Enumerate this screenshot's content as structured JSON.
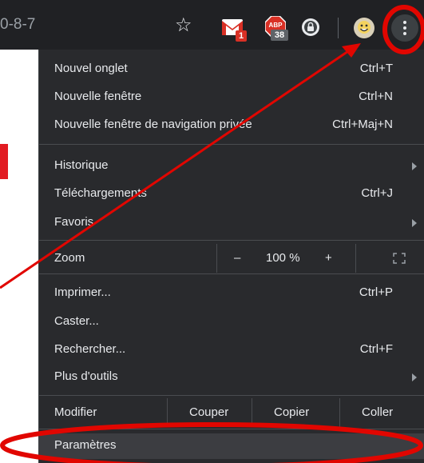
{
  "toolbar": {
    "url_fragment": "0-8-7",
    "gmail_badge": "1",
    "abp_badge": "38",
    "icons": [
      "star-icon",
      "gmail-icon",
      "adblock-icon",
      "lock-extension-icon",
      "avatar",
      "more-icon"
    ]
  },
  "menu": {
    "new_tab": {
      "label": "Nouvel onglet",
      "shortcut": "Ctrl+T"
    },
    "new_window": {
      "label": "Nouvelle fenêtre",
      "shortcut": "Ctrl+N"
    },
    "incognito": {
      "label": "Nouvelle fenêtre de navigation privée",
      "shortcut": "Ctrl+Maj+N"
    },
    "history": {
      "label": "Historique"
    },
    "downloads": {
      "label": "Téléchargements",
      "shortcut": "Ctrl+J"
    },
    "bookmarks": {
      "label": "Favoris"
    },
    "zoom": {
      "label": "Zoom",
      "minus": "–",
      "value": "100 %",
      "plus": "+"
    },
    "print": {
      "label": "Imprimer...",
      "shortcut": "Ctrl+P"
    },
    "cast": {
      "label": "Caster..."
    },
    "find": {
      "label": "Rechercher...",
      "shortcut": "Ctrl+F"
    },
    "more_tools": {
      "label": "Plus d'outils"
    },
    "edit": {
      "label": "Modifier",
      "cut": "Couper",
      "copy": "Copier",
      "paste": "Coller"
    },
    "settings": {
      "label": "Paramètres"
    }
  },
  "colors": {
    "toolbar_bg": "#202124",
    "menu_bg": "#292a2d",
    "annotation_red": "#e10600"
  }
}
